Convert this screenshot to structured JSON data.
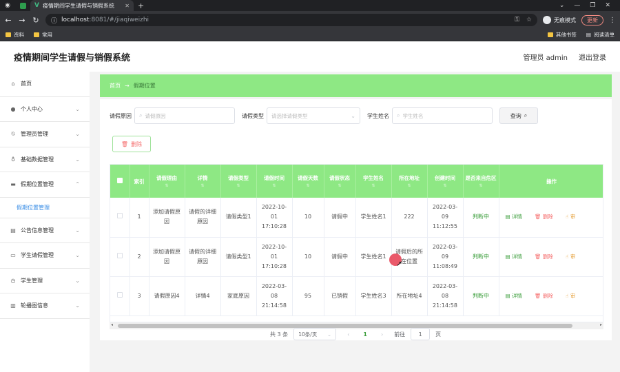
{
  "browser": {
    "tab_title": "疫情期间学生请假与销假系统",
    "url_host": "localhost",
    "url_path": ":8081/#/jiaqiweizhi",
    "incognito_label": "无痕模式",
    "update_label": "更新",
    "bookmarks": [
      "资料",
      "常用"
    ],
    "bookmarks_right": [
      "其他书签",
      "阅读清单"
    ]
  },
  "header": {
    "title": "疫情期间学生请假与销假系统",
    "user": "管理员 admin",
    "logout": "退出登录"
  },
  "sidebar": {
    "items": [
      {
        "label": "首页",
        "icon": "home-icon"
      },
      {
        "label": "个人中心",
        "icon": "user-icon"
      },
      {
        "label": "管理员管理",
        "icon": "bell-off-icon"
      },
      {
        "label": "基础数据管理",
        "icon": "microphone-icon"
      },
      {
        "label": "假期位置管理",
        "icon": "message-icon"
      },
      {
        "label": "公告信息管理",
        "icon": "notice-icon"
      },
      {
        "label": "学生请假管理",
        "icon": "chat-icon"
      },
      {
        "label": "学生管理",
        "icon": "clock-icon"
      },
      {
        "label": "轮播图信息",
        "icon": "chart-icon"
      }
    ],
    "sub_item": "假期位置管理"
  },
  "breadcrumb": {
    "home": "首页",
    "arrow": "→",
    "current": "假期位置"
  },
  "search": {
    "reason_label": "请假原因",
    "reason_placeholder": "请假原因",
    "type_label": "请假类型",
    "type_placeholder": "请选择请假类型",
    "name_label": "学生姓名",
    "name_placeholder": "学生姓名",
    "query_button": "查询",
    "delete_button": "删除"
  },
  "table": {
    "columns": [
      "索引",
      "请假理由",
      "详情",
      "请假类型",
      "请假时间",
      "请假天数",
      "请假状态",
      "学生姓名",
      "所在地址",
      "创建时间",
      "是否来自危区",
      "操作"
    ],
    "rows": [
      {
        "index": "1",
        "reason": "添加请假原因",
        "detail": "请假的详细原因",
        "type": "请假类型1",
        "time": "2022-10-01 17:10:28",
        "days": "10",
        "status": "请假中",
        "student": "学生姓名1",
        "address": "222",
        "created": "2022-03-09 11:12:55",
        "danger": "判断中"
      },
      {
        "index": "2",
        "reason": "添加请假原因",
        "detail": "请假的详细原因",
        "type": "请假类型1",
        "time": "2022-10-01 17:10:28",
        "days": "10",
        "status": "请假中",
        "student": "学生姓名1",
        "address": "请假后的所在位置",
        "created": "2022-03-09 11:08:49",
        "danger": "判断中"
      },
      {
        "index": "3",
        "reason": "请假原因4",
        "detail": "详情4",
        "type": "家庭原因",
        "time": "2022-03-08 21:14:58",
        "days": "95",
        "status": "已销假",
        "student": "学生姓名3",
        "address": "所在地址4",
        "created": "2022-03-08 21:14:58",
        "danger": "判断中"
      }
    ],
    "ops": {
      "detail": "详情",
      "delete": "删除",
      "audit": "审"
    }
  },
  "pagination": {
    "total": "共 3 条",
    "page_size": "10条/页",
    "current": "1",
    "goto_label": "前往",
    "goto_value": "1",
    "page_suffix": "页"
  },
  "colors": {
    "accent_green": "#8ee884",
    "link_blue": "#3a8ee6",
    "danger_red": "#f56c6c"
  }
}
